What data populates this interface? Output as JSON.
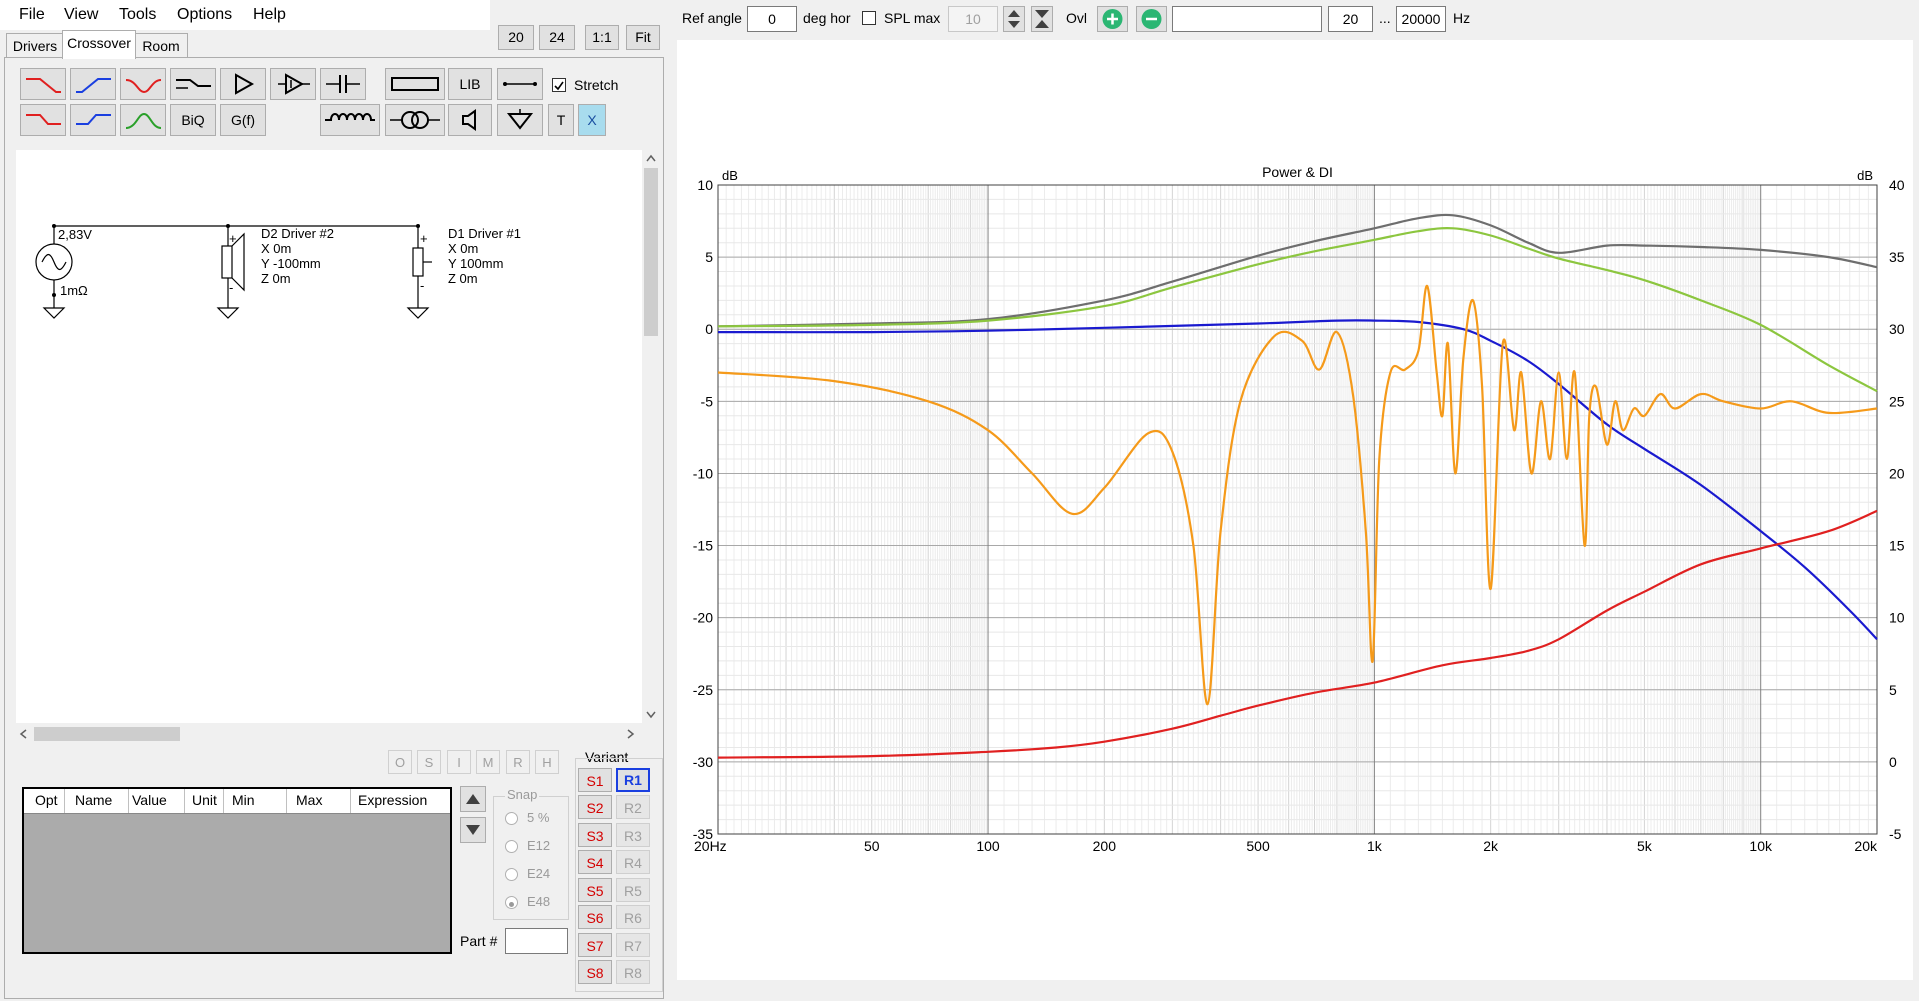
{
  "menu": [
    "File",
    "View",
    "Tools",
    "Options",
    "Help"
  ],
  "tabs": [
    "Drivers",
    "Crossover",
    "Room"
  ],
  "zoom_buttons": [
    "20",
    "24",
    "1:1",
    "Fit"
  ],
  "toolbar": {
    "biq": "BiQ",
    "gf": "G(f)",
    "lib": "LIB",
    "t": "T",
    "x": "X",
    "stretch_label": "Stretch",
    "stretch_checked": true
  },
  "schematic": {
    "source_voltage": "2,83V",
    "source_impedance": "1mΩ",
    "driver2": {
      "name": "D2 Driver #2",
      "x": "X 0m",
      "y": "Y -100mm",
      "z": "Z 0m"
    },
    "driver1": {
      "name": "D1 Driver #1",
      "x": "X 0m",
      "y": "Y 100mm",
      "z": "Z 0m"
    },
    "plus": "+",
    "minus": "-"
  },
  "opt_buttons": [
    "O",
    "S",
    "I",
    "M",
    "R",
    "H"
  ],
  "table_columns": [
    "Opt",
    "Name",
    "Value",
    "Unit",
    "Min",
    "Max",
    "Expression"
  ],
  "snap": {
    "title": "Snap",
    "options": [
      "5 %",
      "E12",
      "E24",
      "E48"
    ],
    "selected": "E48"
  },
  "part_label": "Part #",
  "variant": {
    "title": "Variant",
    "s": [
      "S1",
      "S2",
      "S3",
      "S4",
      "S5",
      "S6",
      "S7",
      "S8"
    ],
    "r": [
      "R1",
      "R2",
      "R3",
      "R4",
      "R5",
      "R6",
      "R7",
      "R8"
    ],
    "active_r": "R1"
  },
  "topbar": {
    "ref_angle_label": "Ref angle",
    "ref_angle_value": "0",
    "deg_hor": "deg hor",
    "spl_max_label": "SPL max",
    "spl_max_value": "10",
    "ovl_label": "Ovl",
    "overlay_name": "",
    "freq_min": "20",
    "ellipsis": "...",
    "freq_max": "20000",
    "hz": "Hz"
  },
  "colors": {
    "power": "#6e6e6e",
    "green": "#8cc63f",
    "blue": "#1a1acf",
    "orange": "#f59a1a",
    "red": "#e02020",
    "add_btn": "#2bb673"
  },
  "chart_data": {
    "type": "line",
    "title": "Power & DI",
    "ylabel": "dB",
    "y2label": "dB",
    "xscale": "log",
    "xlim": [
      20,
      20000
    ],
    "ylim": [
      -35,
      10
    ],
    "y2lim": [
      -5,
      40
    ],
    "xticks": [
      20,
      50,
      100,
      200,
      500,
      1000,
      2000,
      5000,
      10000,
      20000
    ],
    "xtick_labels": [
      "20Hz",
      "50",
      "100",
      "200",
      "500",
      "1k",
      "2k",
      "5k",
      "10k",
      "20k"
    ],
    "yticks": [
      10,
      5,
      0,
      -5,
      -10,
      -15,
      -20,
      -25,
      -30,
      -35
    ],
    "y2ticks": [
      40,
      35,
      30,
      25,
      20,
      15,
      10,
      5,
      0,
      -5
    ],
    "grid": true,
    "series": [
      {
        "color": "#6e6e6e",
        "axis": "left",
        "x": [
          20,
          50,
          100,
          200,
          300,
          500,
          700,
          1000,
          1300,
          1600,
          2000,
          2500,
          3000,
          4000,
          5000,
          7000,
          10000,
          15000,
          20000
        ],
        "y": [
          0.2,
          0.4,
          0.7,
          2.0,
          3.3,
          5.1,
          6.1,
          7.0,
          7.7,
          7.9,
          7.2,
          6.0,
          5.3,
          5.8,
          5.8,
          5.7,
          5.5,
          5.0,
          4.3
        ]
      },
      {
        "color": "#8cc63f",
        "axis": "left",
        "x": [
          20,
          50,
          100,
          200,
          300,
          500,
          700,
          1000,
          1300,
          1600,
          2000,
          2500,
          3000,
          4000,
          5000,
          7000,
          10000,
          15000,
          20000
        ],
        "y": [
          0.2,
          0.3,
          0.6,
          1.6,
          2.9,
          4.5,
          5.4,
          6.2,
          6.8,
          7.0,
          6.5,
          5.6,
          4.9,
          4.1,
          3.4,
          2.0,
          0.3,
          -2.5,
          -4.3
        ]
      },
      {
        "color": "#1a1acf",
        "axis": "left",
        "x": [
          20,
          50,
          100,
          200,
          500,
          800,
          1000,
          1300,
          1700,
          2000,
          2500,
          3000,
          4000,
          5000,
          7000,
          10000,
          13000,
          17000,
          20000
        ],
        "y": [
          -0.2,
          -0.2,
          -0.1,
          0.1,
          0.4,
          0.6,
          0.6,
          0.5,
          0.0,
          -0.8,
          -2.2,
          -3.8,
          -6.6,
          -8.3,
          -10.8,
          -14.0,
          -16.5,
          -19.5,
          -21.5
        ]
      },
      {
        "color": "#f59a1a",
        "axis": "left",
        "x": [
          20,
          40,
          70,
          100,
          130,
          165,
          200,
          260,
          300,
          340,
          370,
          400,
          450,
          550,
          650,
          720,
          800,
          880,
          950,
          990,
          1030,
          1100,
          1200,
          1300,
          1370,
          1450,
          1500,
          1550,
          1620,
          1700,
          1800,
          1900,
          2000,
          2150,
          2300,
          2400,
          2550,
          2700,
          2850,
          3000,
          3150,
          3300,
          3500,
          3600,
          3750,
          4000,
          4200,
          4400,
          4700,
          5000,
          5500,
          6000,
          7000,
          8000,
          10000,
          12000,
          15000,
          20000
        ],
        "y": [
          -3.0,
          -3.6,
          -5.0,
          -7.0,
          -10.0,
          -12.8,
          -11.0,
          -7.2,
          -8.5,
          -15.0,
          -26.0,
          -14.0,
          -5.0,
          -0.5,
          -0.8,
          -2.8,
          -0.2,
          -4.5,
          -14.0,
          -23.0,
          -9.0,
          -3.0,
          -2.8,
          -1.5,
          3.0,
          -3.0,
          -6.0,
          -1.0,
          -10.0,
          -2.0,
          2.0,
          -4.0,
          -18.0,
          -1.0,
          -7.0,
          -3.0,
          -10.0,
          -5.0,
          -9.0,
          -3.0,
          -9.0,
          -3.0,
          -15.0,
          -6.0,
          -4.0,
          -8.0,
          -5.0,
          -7.0,
          -5.5,
          -6.0,
          -4.5,
          -5.5,
          -4.5,
          -5.0,
          -5.5,
          -5.0,
          -5.8,
          -5.5
        ]
      },
      {
        "color": "#e02020",
        "axis": "left",
        "x": [
          20,
          50,
          100,
          150,
          200,
          300,
          400,
          500,
          700,
          1000,
          1500,
          2000,
          2500,
          3000,
          4000,
          5000,
          7000,
          10000,
          15000,
          20000
        ],
        "y": [
          -29.7,
          -29.6,
          -29.3,
          -29.0,
          -28.6,
          -27.7,
          -26.8,
          -26.1,
          -25.2,
          -24.5,
          -23.3,
          -22.8,
          -22.3,
          -21.5,
          -19.5,
          -18.2,
          -16.3,
          -15.2,
          -14.0,
          -12.6
        ]
      }
    ]
  }
}
